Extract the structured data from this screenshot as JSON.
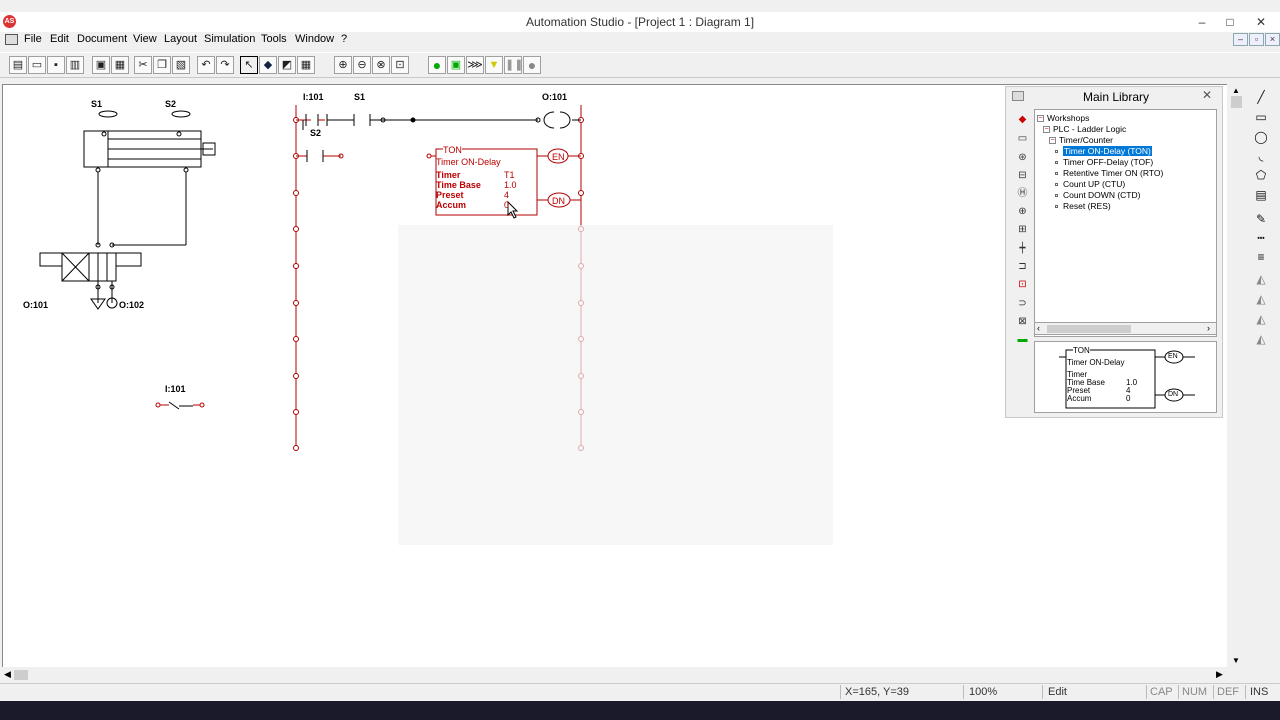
{
  "window": {
    "title": "Automation Studio - [Project 1 : Diagram 1]",
    "app_icon": "AS",
    "controls": [
      "–",
      "□",
      "✕"
    ]
  },
  "menubar": {
    "items": [
      "File",
      "Edit",
      "Document",
      "View",
      "Layout",
      "Simulation",
      "Tools",
      "Window",
      "?"
    ],
    "mdi_controls": [
      "–",
      "▫",
      "×"
    ]
  },
  "toolbar": {
    "buttons": [
      "new-document-icon",
      "open-folder-icon",
      "save-icon",
      "print-icon",
      "new-project-icon",
      "properties-icon",
      "cut-icon",
      "copy-icon",
      "paste-icon",
      "undo-icon",
      "redo-icon",
      "select-arrow-icon",
      "library-icon",
      "chart-icon",
      "grid-icon",
      "zoom-in-icon",
      "zoom-out-icon",
      "zoom-area-icon",
      "zoom-fit-icon",
      "run-simulation-icon",
      "step-icon",
      "slow-motion-icon",
      "pause-icon",
      "stop-icon"
    ]
  },
  "diagram": {
    "pneumatic": {
      "s1": "S1",
      "s2": "S2",
      "o101": "O:101",
      "o102": "O:102",
      "i101": "I:101"
    },
    "ladder": {
      "i101": "I:101",
      "s1": "S1",
      "s2": "S2",
      "o101": "O:101",
      "ton": {
        "header": "TON",
        "name": "Timer ON-Delay",
        "timer_label": "Timer",
        "timer_value": "T1",
        "timebase_label": "Time Base",
        "timebase_value": "1.0",
        "preset_label": "Preset",
        "preset_value": "4",
        "accum_label": "Accum",
        "accum_value": "0",
        "en": "EN",
        "dn": "DN"
      }
    }
  },
  "library": {
    "title": "Main Library",
    "close": "✕",
    "tree": [
      {
        "label": "Workshops",
        "level": 0,
        "type": "folder"
      },
      {
        "label": "PLC - Ladder Logic",
        "level": 1,
        "type": "folder"
      },
      {
        "label": "Timer/Counter",
        "level": 2,
        "type": "folder"
      },
      {
        "label": "Timer ON-Delay (TON)",
        "level": 3,
        "type": "item",
        "selected": true
      },
      {
        "label": "Timer OFF-Delay (TOF)",
        "level": 3,
        "type": "item"
      },
      {
        "label": "Retentive Timer ON (RTO)",
        "level": 3,
        "type": "item"
      },
      {
        "label": "Count UP (CTU)",
        "level": 3,
        "type": "item"
      },
      {
        "label": "Count DOWN (CTD)",
        "level": 3,
        "type": "item"
      },
      {
        "label": "Reset (RES)",
        "level": 3,
        "type": "item"
      }
    ],
    "preview": {
      "header": "TON",
      "name": "Timer ON-Delay",
      "timer_label": "Timer",
      "timebase_label": "Time Base",
      "timebase_value": "1.0",
      "preset_label": "Preset",
      "preset_value": "4",
      "accum_label": "Accum",
      "accum_value": "0",
      "en": "EN",
      "dn": "DN"
    }
  },
  "statusbar": {
    "coords": "X=165, Y=39",
    "zoom": "100%",
    "mode": "Edit",
    "cap": "CAP",
    "num": "NUM",
    "def": "DEF",
    "ins": "INS"
  },
  "colors": {
    "ladder_red": "#b00000",
    "selection_blue": "#0078d7"
  }
}
